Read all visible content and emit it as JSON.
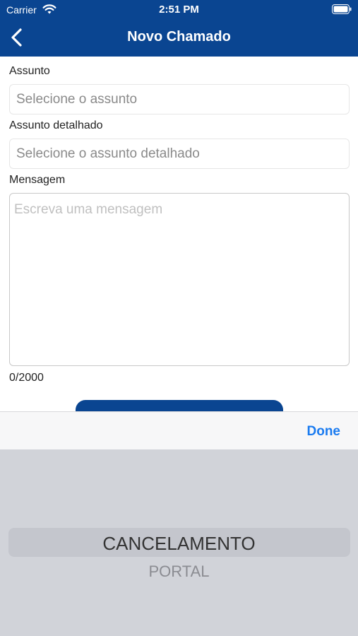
{
  "status_bar": {
    "carrier": "Carrier",
    "time": "2:51 PM"
  },
  "nav": {
    "title": "Novo Chamado",
    "back_icon": "chevron-left-icon"
  },
  "form": {
    "subject_label": "Assunto",
    "subject_placeholder": "Selecione o assunto",
    "detail_label": "Assunto detalhado",
    "detail_placeholder": "Selecione o assunto detalhado",
    "message_label": "Mensagem",
    "message_placeholder": "Escreva uma mensagem",
    "counter": "0/2000"
  },
  "picker": {
    "done_label": "Done",
    "options": [
      "CANCELAMENTO",
      "PORTAL"
    ],
    "selected": "CANCELAMENTO"
  },
  "colors": {
    "brand_blue": "#0a4591",
    "done_blue": "#1a7bf0",
    "picker_bg": "#d1d3d9"
  }
}
